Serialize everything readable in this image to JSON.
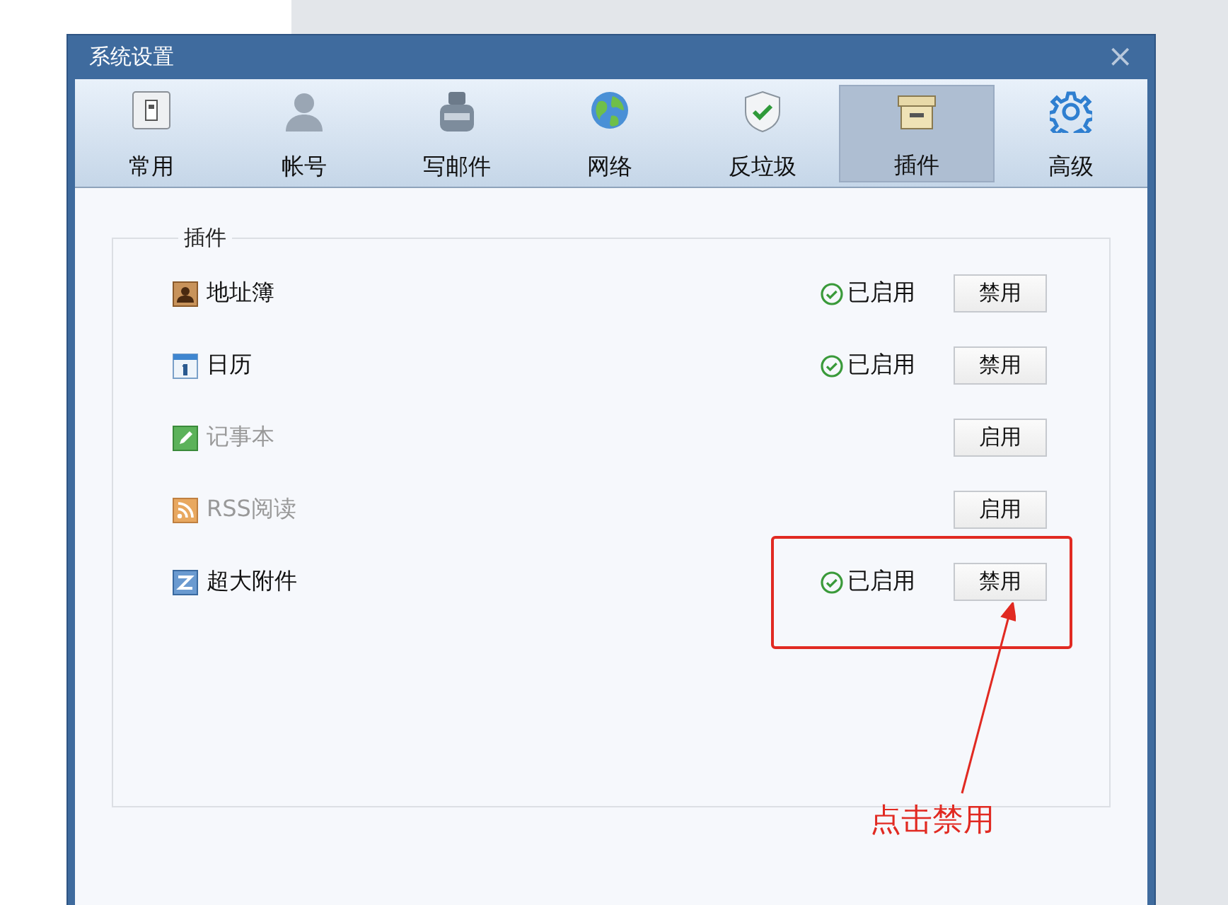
{
  "window": {
    "title": "系统设置",
    "close": "×"
  },
  "tabs": [
    {
      "label": "常用",
      "kind": "switch",
      "selected": false
    },
    {
      "label": "帐号",
      "kind": "person",
      "selected": false
    },
    {
      "label": "写邮件",
      "kind": "ink",
      "selected": false
    },
    {
      "label": "网络",
      "kind": "globe",
      "selected": false
    },
    {
      "label": "反垃圾",
      "kind": "shield",
      "selected": false
    },
    {
      "label": "插件",
      "kind": "box",
      "selected": true
    },
    {
      "label": "高级",
      "kind": "gear",
      "selected": false
    }
  ],
  "group": {
    "title": "插件"
  },
  "plugins": [
    {
      "name": "地址簿",
      "kind": "contacts",
      "enabled": true,
      "status": "已启用",
      "button": "禁用",
      "highlighted": false
    },
    {
      "name": "日历",
      "kind": "calendar",
      "enabled": true,
      "status": "已启用",
      "button": "禁用",
      "highlighted": false
    },
    {
      "name": "记事本",
      "kind": "notes",
      "enabled": false,
      "button": "启用",
      "highlighted": false
    },
    {
      "name": "RSS阅读",
      "kind": "rss",
      "enabled": false,
      "button": "启用",
      "highlighted": false
    },
    {
      "name": "超大附件",
      "kind": "attachment",
      "enabled": true,
      "status": "已启用",
      "button": "禁用",
      "highlighted": true
    }
  ],
  "annotation": {
    "text": "点击禁用"
  }
}
